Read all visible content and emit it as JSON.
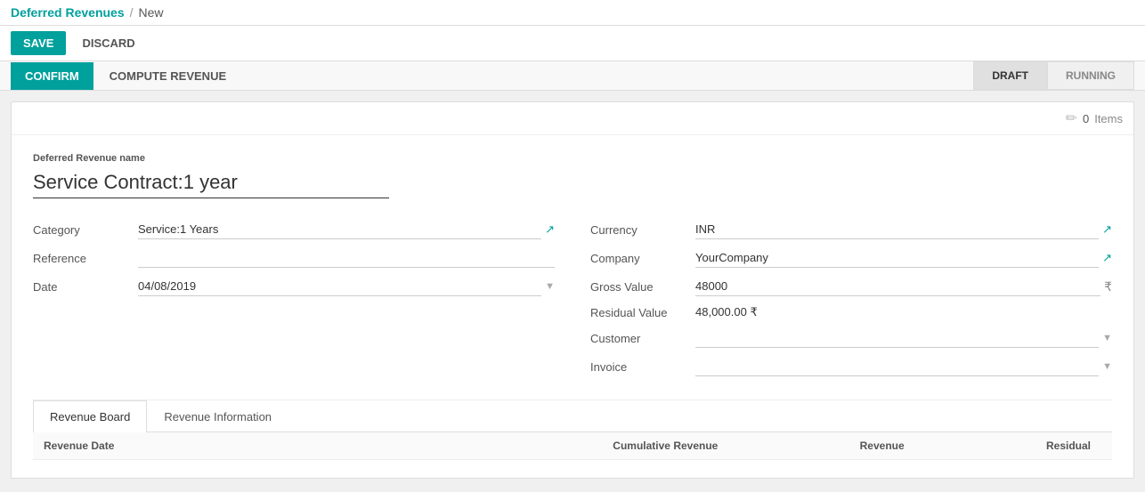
{
  "breadcrumb": {
    "app": "Deferred Revenues",
    "separator": "/",
    "current": "New"
  },
  "toolbar": {
    "save_label": "SAVE",
    "discard_label": "DISCARD"
  },
  "actions": {
    "confirm_label": "CONFIRM",
    "compute_label": "COMPUTE REVENUE"
  },
  "status": {
    "pills": [
      {
        "label": "DRAFT",
        "active": true
      },
      {
        "label": "RUNNING",
        "active": false
      }
    ]
  },
  "items_widget": {
    "icon": "✏",
    "count": "0",
    "label": "Items"
  },
  "form": {
    "revenue_name_label": "Deferred Revenue name",
    "revenue_name_value": "Service Contract:1 year",
    "left": {
      "category_label": "Category",
      "category_value": "Service:1 Years",
      "reference_label": "Reference",
      "reference_value": "",
      "date_label": "Date",
      "date_value": "04/08/2019"
    },
    "right": {
      "currency_label": "Currency",
      "currency_value": "INR",
      "company_label": "Company",
      "company_value": "YourCompany",
      "gross_value_label": "Gross Value",
      "gross_value_value": "48000",
      "residual_label": "Residual Value",
      "residual_value": "48,000.00 ₹",
      "customer_label": "Customer",
      "customer_value": "",
      "invoice_label": "Invoice",
      "invoice_value": ""
    }
  },
  "tabs": [
    {
      "label": "Revenue Board",
      "active": true
    },
    {
      "label": "Revenue Information",
      "active": false
    }
  ],
  "table": {
    "headers": [
      {
        "label": "Revenue Date",
        "key": "date"
      },
      {
        "label": "Cumulative Revenue",
        "key": "cumulative"
      },
      {
        "label": "Revenue",
        "key": "revenue"
      },
      {
        "label": "Residual",
        "key": "residual"
      }
    ]
  }
}
